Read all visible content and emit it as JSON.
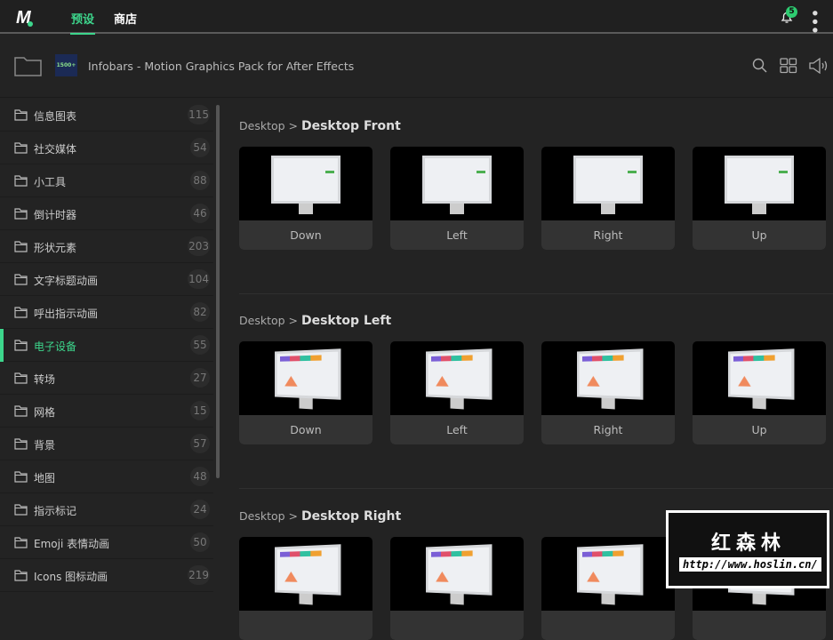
{
  "topbar": {
    "logo": "M",
    "tabs": [
      {
        "label": "预设",
        "active": true
      },
      {
        "label": "商店",
        "active": false
      }
    ],
    "notifications": "5"
  },
  "header": {
    "thumb_text": "1500+",
    "title": "Infobars - Motion Graphics Pack for After Effects"
  },
  "sidebar": {
    "items": [
      {
        "label": "信息图表",
        "count": "115"
      },
      {
        "label": "社交媒体",
        "count": "54"
      },
      {
        "label": "小工具",
        "count": "88"
      },
      {
        "label": "倒计时器",
        "count": "46"
      },
      {
        "label": "形状元素",
        "count": "203"
      },
      {
        "label": "文字标题动画",
        "count": "104"
      },
      {
        "label": "呼出指示动画",
        "count": "82"
      },
      {
        "label": "电子设备",
        "count": "55"
      },
      {
        "label": "转场",
        "count": "27"
      },
      {
        "label": "网格",
        "count": "15"
      },
      {
        "label": "背景",
        "count": "57"
      },
      {
        "label": "地图",
        "count": "48"
      },
      {
        "label": "指示标记",
        "count": "24"
      },
      {
        "label": "Emoji 表情动画",
        "count": "50"
      },
      {
        "label": "Icons 图标动画",
        "count": "219"
      }
    ]
  },
  "sections": [
    {
      "parent": "Desktop >",
      "title": "Desktop Front",
      "cards": [
        "Down",
        "Left",
        "Right",
        "Up"
      ]
    },
    {
      "parent": "Desktop >",
      "title": "Desktop Left",
      "cards": [
        "Down",
        "Left",
        "Right",
        "Up"
      ]
    },
    {
      "parent": "Desktop >",
      "title": "Desktop Right",
      "cards": [
        "",
        "",
        "",
        ""
      ]
    }
  ],
  "watermark": {
    "title": "红森林",
    "url": "http://www.hoslin.cn/"
  },
  "colors": {
    "accent": "#3dd68c",
    "background": "#232323"
  }
}
